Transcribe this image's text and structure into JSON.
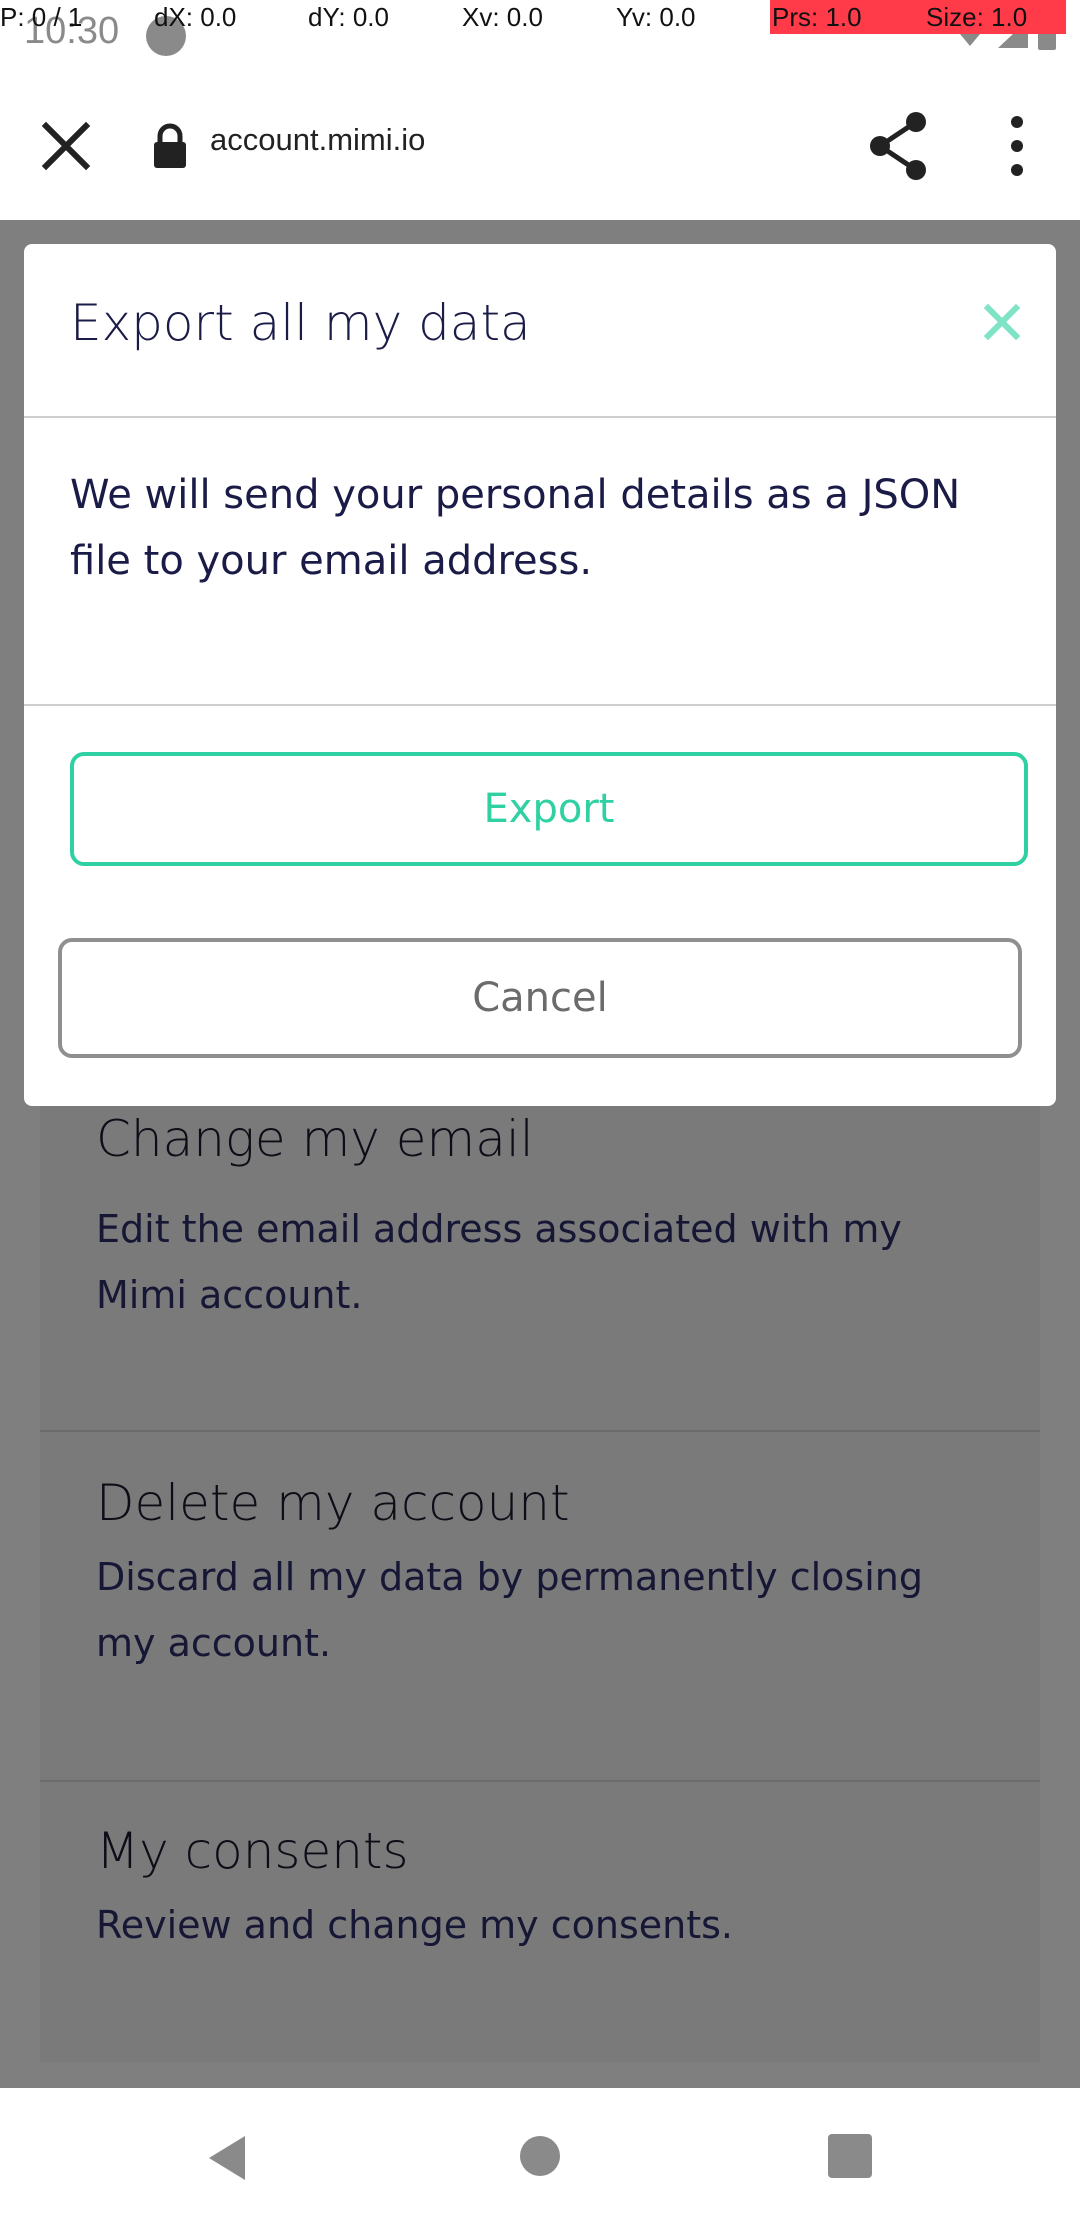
{
  "status": {
    "time": "10:30",
    "pointer": {
      "p": "P: 0 / 1",
      "dx": "dX: 0.0",
      "dy": "dY: 0.0",
      "xv": "Xv: 0.0",
      "yv": "Yv: 0.0",
      "prs": "Prs: 1.0",
      "size": "Size: 1.0"
    }
  },
  "toolbar": {
    "url": "account.mimi.io",
    "close_icon": "close-icon",
    "lock_icon": "lock-icon",
    "share_icon": "share-icon",
    "menu_icon": "more-vert-icon"
  },
  "background": {
    "cards": [
      {
        "title": "Change my email",
        "desc": "Edit the email address associated with my Mimi account."
      },
      {
        "title": "Delete my account",
        "desc": "Discard all my data by permanently closing my account."
      },
      {
        "title": "My consents",
        "desc": "Review and change my consents."
      }
    ]
  },
  "modal": {
    "title": "Export all my data",
    "body": "We will send your personal details as a JSON file to your email address.",
    "export_label": "Export",
    "cancel_label": "Cancel"
  },
  "colors": {
    "accent": "#2fd1a2",
    "title_text": "#1b1b48",
    "overlay": "rgba(0,0,0,0.5)"
  }
}
